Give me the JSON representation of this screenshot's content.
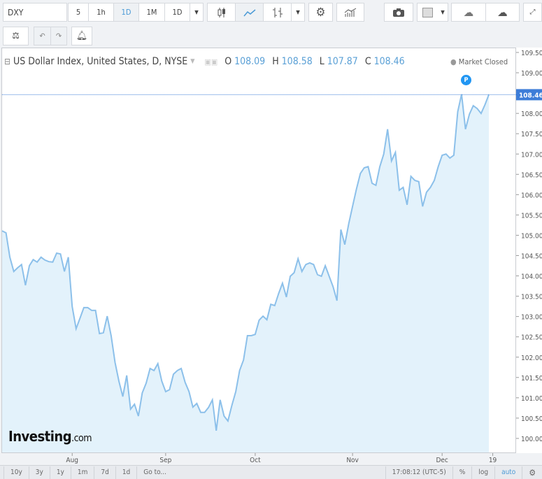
{
  "toolbar": {
    "symbol": "DXY",
    "intervals": [
      "5",
      "1h",
      "1D",
      "1M",
      "1D"
    ],
    "selected_interval": "1D",
    "icons": [
      "candlestick-icon",
      "line-chart-icon",
      "bar-chart-icon",
      "settings-gear-icon",
      "indicators-icon",
      "camera-icon",
      "color-box-icon",
      "cloud-download-icon",
      "cloud-upload-icon",
      "fullscreen-icon",
      "scale-icon",
      "undo-icon",
      "redo-icon",
      "add-alert-icon"
    ]
  },
  "legend": {
    "title": "US Dollar Index, United States, D, NYSE",
    "o_label": "O",
    "o": "108.09",
    "h_label": "H",
    "h": "108.58",
    "l_label": "L",
    "l": "107.87",
    "c_label": "C",
    "c": "108.46",
    "status": "Market Closed",
    "marker": "P"
  },
  "bottom": {
    "ranges": [
      "10y",
      "3y",
      "1y",
      "1m",
      "7d",
      "1d"
    ],
    "goto": "Go to...",
    "time": "17:08:12 (UTC-5)",
    "percent": "%",
    "log": "log",
    "auto": "auto"
  },
  "colors": {
    "line": "#8cc0ea",
    "fill": "#e3f2fb",
    "accent": "#4a9ad6",
    "price_label": "#3d7dd8"
  },
  "chart_data": {
    "type": "area",
    "title": "US Dollar Index, United States, D, NYSE",
    "ylim": [
      99.8,
      109.7
    ],
    "yticks": [
      "109.50",
      "109.00",
      "108.50",
      "108.00",
      "107.50",
      "107.00",
      "106.50",
      "106.00",
      "105.50",
      "105.00",
      "104.50",
      "104.00",
      "103.50",
      "103.00",
      "102.50",
      "102.00",
      "101.50",
      "101.00",
      "100.50",
      "100.00"
    ],
    "xticks": [
      {
        "label": "Aug",
        "at_point": 18
      },
      {
        "label": "Sep",
        "at_point": 42
      },
      {
        "label": "Oct",
        "at_point": 65
      },
      {
        "label": "Nov",
        "at_point": 90
      },
      {
        "label": "Dec",
        "at_point": 113
      },
      {
        "label": "19",
        "at_point": 126
      }
    ],
    "last_price": "108.46",
    "grid": false,
    "values": [
      105.11,
      105.06,
      104.46,
      104.11,
      104.2,
      104.28,
      103.77,
      104.25,
      104.4,
      104.34,
      104.46,
      104.39,
      104.35,
      104.34,
      104.56,
      104.54,
      104.11,
      104.46,
      103.25,
      102.7,
      102.96,
      103.22,
      103.22,
      103.15,
      103.15,
      102.58,
      102.6,
      103.01,
      102.53,
      101.87,
      101.41,
      101.03,
      101.55,
      100.72,
      100.84,
      100.55,
      101.12,
      101.36,
      101.72,
      101.67,
      101.84,
      101.41,
      101.15,
      101.2,
      101.58,
      101.67,
      101.72,
      101.38,
      101.15,
      100.77,
      100.86,
      100.64,
      100.64,
      100.76,
      100.95,
      100.19,
      100.95,
      100.55,
      100.43,
      100.81,
      101.15,
      101.67,
      101.93,
      102.53,
      102.53,
      102.56,
      102.91,
      103.01,
      102.92,
      103.3,
      103.27,
      103.56,
      103.82,
      103.48,
      103.99,
      104.08,
      104.42,
      104.11,
      104.28,
      104.32,
      104.28,
      104.03,
      103.99,
      104.25,
      103.99,
      103.73,
      103.39,
      105.14,
      104.77,
      105.28,
      105.71,
      106.14,
      106.52,
      106.66,
      106.69,
      106.28,
      106.23,
      106.69,
      107.0,
      107.61,
      106.83,
      107.04,
      106.11,
      106.18,
      105.75,
      106.45,
      106.35,
      106.32,
      105.71,
      106.06,
      106.18,
      106.35,
      106.69,
      106.97,
      107.0,
      106.9,
      106.97,
      108.04,
      108.47,
      107.61,
      107.98,
      108.19,
      108.12,
      108.0,
      108.21,
      108.46
    ]
  }
}
